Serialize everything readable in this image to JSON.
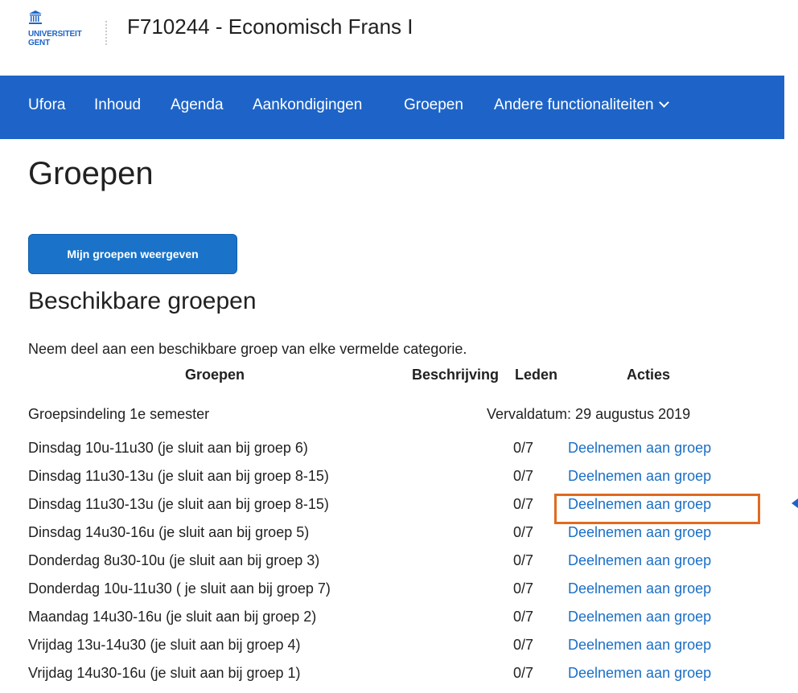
{
  "header": {
    "logo_text_1": "UNIVERSITEIT",
    "logo_text_2": "GENT",
    "course_title": "F710244 - Economisch Frans I"
  },
  "nav": {
    "items": [
      "Ufora",
      "Inhoud",
      "Agenda",
      "Aankondigingen",
      "Groepen"
    ],
    "more_label": "Andere functionaliteiten"
  },
  "page": {
    "title": "Groepen",
    "my_groups_button": "Mijn groepen weergeven",
    "section_title": "Beschikbare groepen",
    "intro": "Neem deel aan een beschikbare groep van elke vermelde categorie."
  },
  "table": {
    "headers": {
      "groups": "Groepen",
      "description": "Beschrijving",
      "members": "Leden",
      "actions": "Acties"
    },
    "category": {
      "name": "Groepsindeling 1e semester",
      "due": "Vervaldatum: 29 augustus 2019"
    },
    "rows": [
      {
        "name": "Dinsdag 10u-11u30 (je sluit aan bij groep 6)",
        "members": "0/7",
        "action": "Deelnemen aan groep"
      },
      {
        "name": "Dinsdag 11u30-13u (je sluit aan bij groep 8-15)",
        "members": "0/7",
        "action": "Deelnemen aan groep"
      },
      {
        "name": "Dinsdag 11u30-13u (je sluit aan bij groep 8-15)",
        "members": "0/7",
        "action": "Deelnemen aan groep"
      },
      {
        "name": "Dinsdag 14u30-16u (je sluit aan bij groep 5)",
        "members": "0/7",
        "action": "Deelnemen aan groep"
      },
      {
        "name": "Donderdag 8u30-10u (je sluit aan bij groep 3)",
        "members": "0/7",
        "action": "Deelnemen aan groep"
      },
      {
        "name": "Donderdag 10u-11u30 ( je sluit aan bij groep 7)",
        "members": "0/7",
        "action": "Deelnemen aan groep"
      },
      {
        "name": "Maandag 14u30-16u (je sluit aan bij groep 2)",
        "members": "0/7",
        "action": "Deelnemen aan groep"
      },
      {
        "name": "Vrijdag 13u-14u30 (je sluit aan bij groep 4)",
        "members": "0/7",
        "action": "Deelnemen aan groep"
      },
      {
        "name": "Vrijdag 14u30-16u (je sluit aan bij groep 1)",
        "members": "0/7",
        "action": "Deelnemen aan groep"
      }
    ]
  },
  "colors": {
    "nav_bg": "#1e64c8",
    "button_bg": "#1a73c8",
    "link": "#1a6fc7",
    "highlight": "#e06a1f"
  }
}
